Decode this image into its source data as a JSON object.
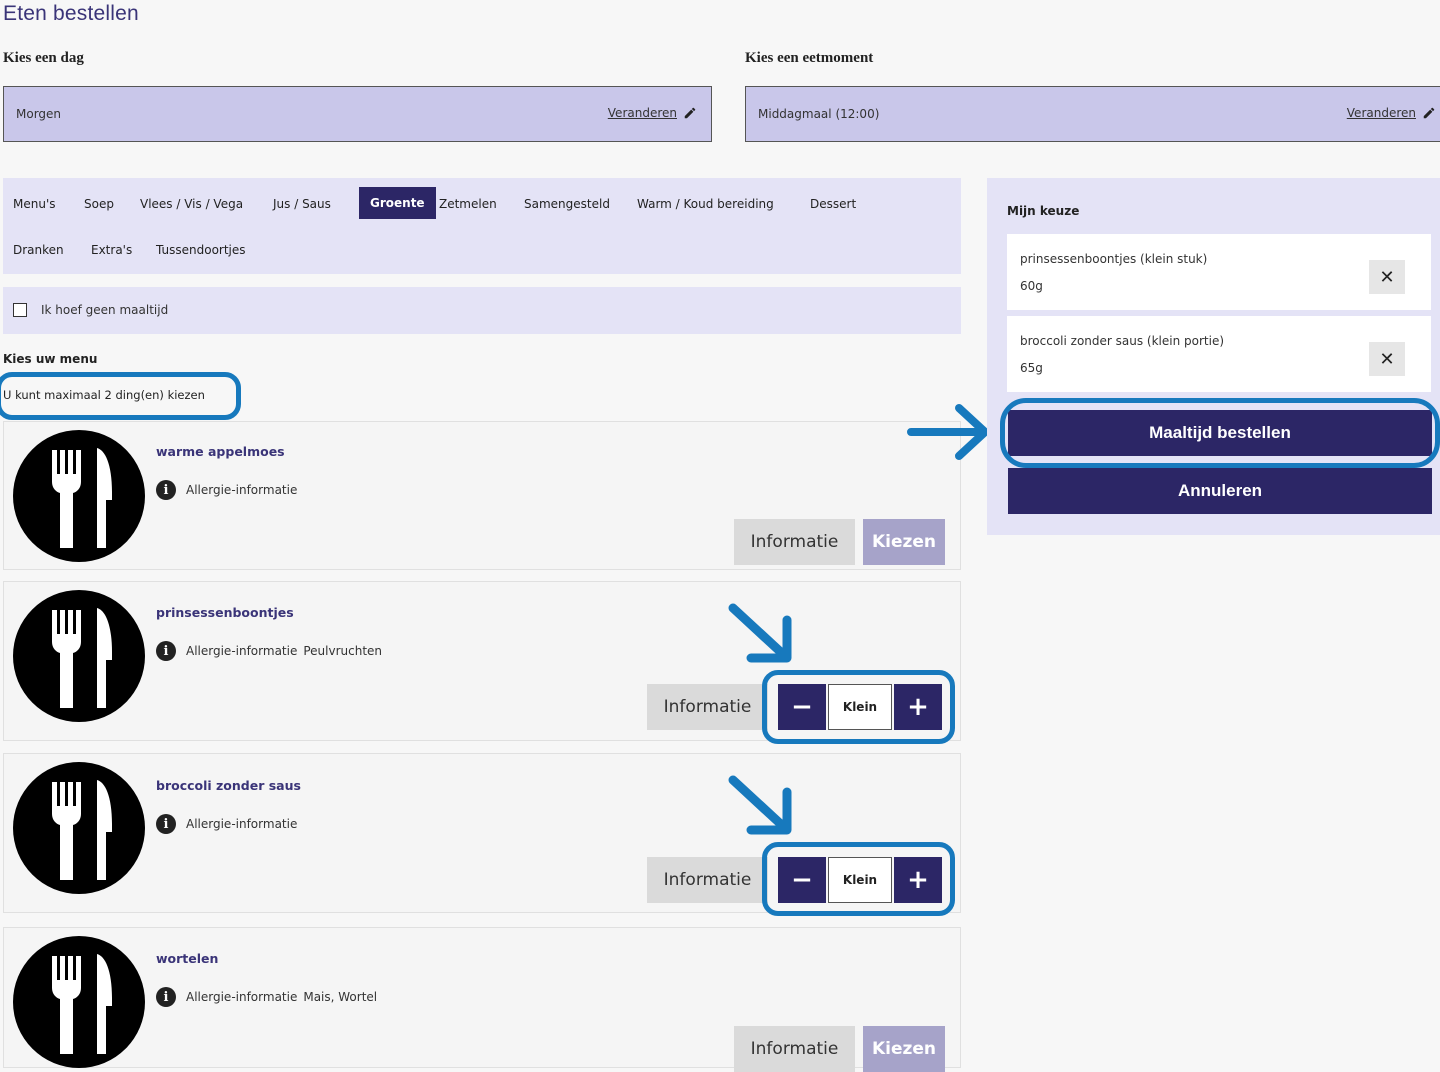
{
  "page": {
    "title": "Eten bestellen"
  },
  "day": {
    "label": "Kies een dag",
    "value": "Morgen",
    "change": "Veranderen"
  },
  "moment": {
    "label": "Kies een eetmoment",
    "value": "Middagmaal (12:00)",
    "change": "Veranderen"
  },
  "tabs": [
    "Menu's",
    "Soep",
    "Vlees / Vis / Vega",
    "Jus / Saus",
    "Groente",
    "Zetmelen",
    "Samengesteld",
    "Warm / Koud bereiding",
    "Dessert",
    "Dranken",
    "Extra's",
    "Tussendoortjes"
  ],
  "active_tab": "Groente",
  "no_meal": {
    "label": "Ik hoef geen maaltijd",
    "checked": false
  },
  "menu": {
    "heading": "Kies uw menu",
    "max_text": "U kunt maximaal 2 ding(en) kiezen",
    "items": [
      {
        "name": "warme appelmoes",
        "allergy": "Allergie-informatie",
        "tags": "",
        "info": "Informatie",
        "choose": "Kiezen"
      },
      {
        "name": "prinsessenboontjes",
        "allergy": "Allergie-informatie",
        "tags": "Peulvruchten",
        "info": "Informatie",
        "size": "Klein"
      },
      {
        "name": "broccoli zonder saus",
        "allergy": "Allergie-informatie",
        "tags": "",
        "info": "Informatie",
        "size": "Klein"
      },
      {
        "name": "wortelen",
        "allergy": "Allergie-informatie",
        "tags": "Mais, Wortel",
        "info": "Informatie",
        "choose": "Kiezen"
      }
    ]
  },
  "selection": {
    "title": "Mijn keuze",
    "items": [
      {
        "name": "prinsessenboontjes (klein stuk)",
        "weight": "60g"
      },
      {
        "name": "broccoli zonder saus (klein portie)",
        "weight": "65g"
      }
    ],
    "order": "Maaltijd bestellen",
    "cancel": "Annuleren"
  },
  "colors": {
    "primary": "#2c2666",
    "panel": "#e4e3f6",
    "picker": "#c9c7ea",
    "highlight": "#1779bd",
    "disabled": "#a6a3c9"
  }
}
